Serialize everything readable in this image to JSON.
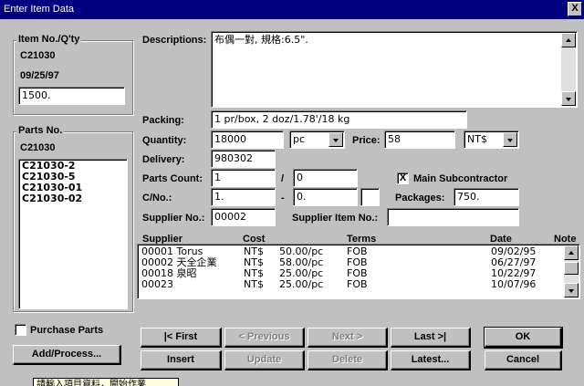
{
  "window": {
    "title": "Enter Item Data",
    "close_glyph": "X"
  },
  "item_group": {
    "legend": "Item No./Q'ty",
    "item_no": "C21030",
    "date": "09/25/97",
    "qty_value": "1500."
  },
  "parts_group": {
    "legend": "Parts No.",
    "current": "C21030",
    "items": [
      "C21030-2",
      "C21030-5",
      "C21030-01",
      "C21030-02"
    ]
  },
  "form": {
    "descriptions_label": "Descriptions:",
    "descriptions_value": "布偶一對, 規格:6.5\".",
    "packing_label": "Packing:",
    "packing_value": "1 pr/box, 2 doz/1.78'/18 kg",
    "quantity_label": "Quantity:",
    "quantity_value": "18000",
    "unit_value": "pc",
    "price_label": "Price:",
    "price_value": "58",
    "currency_value": "NT$",
    "delivery_label": "Delivery:",
    "delivery_value": "980302",
    "parts_count_label": "Parts Count:",
    "parts_count_value": "1",
    "parts_count_sep": "/",
    "parts_count_total": "0",
    "main_sub_label": "Main Subcontractor",
    "main_sub_checked": "X",
    "cno_label": "C/No.:",
    "cno_from": "1.",
    "cno_sep": "-",
    "cno_to": "0.",
    "packages_label": "Packages:",
    "packages_value": "750.",
    "supplier_no_label": "Supplier No.:",
    "supplier_no_value": "00002",
    "supplier_item_label": "Supplier Item No.:",
    "supplier_item_value": ""
  },
  "grid": {
    "headers": [
      "Supplier",
      "Cost",
      "Terms",
      "Date",
      "Note"
    ],
    "rows": [
      {
        "supplier": "00001 Torus",
        "cur": "NT$",
        "cost": "50.00/pc",
        "terms": "FOB",
        "date": "09/02/95"
      },
      {
        "supplier": "00002 天全企業",
        "cur": "NT$",
        "cost": "58.00/pc",
        "terms": "FOB",
        "date": "06/27/97"
      },
      {
        "supplier": "00018 泉昭",
        "cur": "NT$",
        "cost": "25.00/pc",
        "terms": "FOB",
        "date": "10/22/97"
      },
      {
        "supplier": "00023",
        "cur": "NT$",
        "cost": "25.00/pc",
        "terms": "FOB",
        "date": "10/07/96"
      }
    ]
  },
  "purchase_parts": {
    "label": "Purchase Parts",
    "checked": ""
  },
  "buttons": {
    "add_process": "Add/Process...",
    "first": "|< First",
    "previous": "< Previous",
    "next": "Next >",
    "last": "Last >|",
    "ok": "OK",
    "insert": "Insert",
    "update": "Update",
    "delete": "Delete",
    "latest": "Latest...",
    "cancel": "Cancel"
  },
  "status": {
    "text": "請輸入項目資料，開始作業"
  }
}
